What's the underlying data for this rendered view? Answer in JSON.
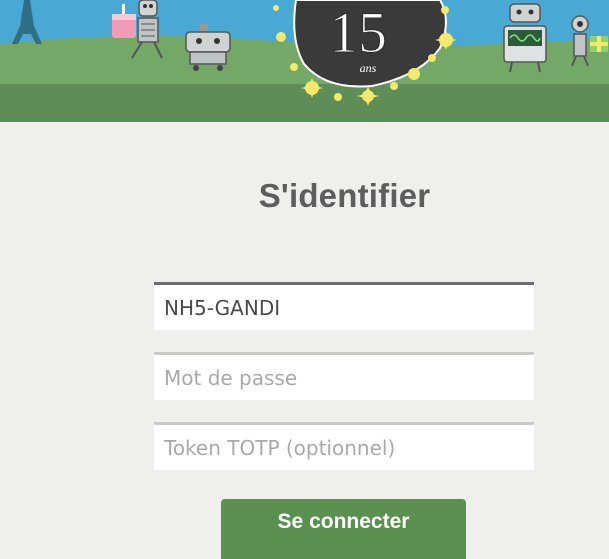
{
  "banner": {
    "badge_number": "15",
    "badge_suffix": "ans"
  },
  "login": {
    "title": "S'identifier",
    "username_value": "NH5-GANDI",
    "password_placeholder": "Mot de passe",
    "totp_placeholder": "Token TOTP (optionnel)",
    "submit_label": "Se connecter"
  },
  "colors": {
    "sky": "#4aa9d4",
    "grass": "#6fa562",
    "ground": "#5f8d57",
    "page_background": "#efefeb",
    "button": "#5a9150"
  }
}
